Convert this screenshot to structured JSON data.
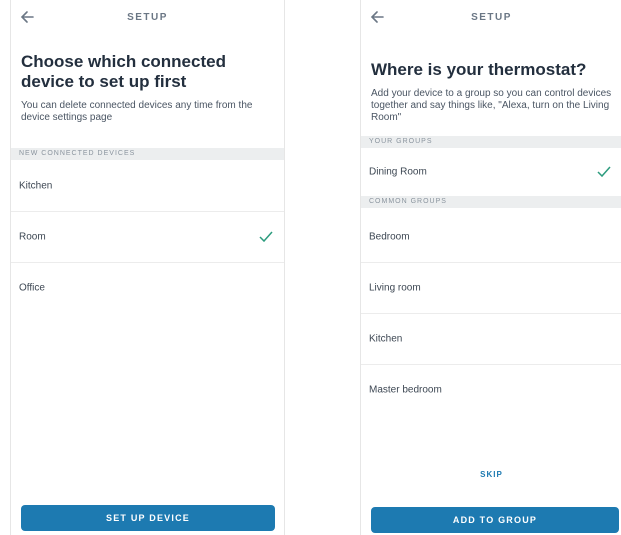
{
  "left_screen": {
    "header_title": "SETUP",
    "heading": "Choose which connected device to set up first",
    "description": "You can delete connected devices any time from the device settings page",
    "section_header": "NEW CONNECTED DEVICES",
    "devices": [
      {
        "label": "Kitchen",
        "selected": false
      },
      {
        "label": "Room",
        "selected": true
      },
      {
        "label": "Office",
        "selected": false
      }
    ],
    "primary_button": "SET UP DEVICE"
  },
  "right_screen": {
    "header_title": "SETUP",
    "heading": "Where is your thermostat?",
    "description": "Add your device to a group so you can control devices together and say things like, \"Alexa, turn on the Living Room\"",
    "your_groups_header": "YOUR GROUPS",
    "your_groups": [
      {
        "label": "Dining Room",
        "selected": true
      }
    ],
    "common_groups_header": "COMMON GROUPS",
    "common_groups": [
      {
        "label": "Bedroom"
      },
      {
        "label": "Living room"
      },
      {
        "label": "Kitchen"
      },
      {
        "label": "Master bedroom"
      }
    ],
    "skip_label": "SKIP",
    "primary_button": "ADD TO GROUP"
  },
  "colors": {
    "accent": "#1d7ab1",
    "check": "#2c9c7e",
    "heading": "#232f3e"
  },
  "icons": {
    "back": "back-arrow-icon",
    "check": "checkmark-icon"
  }
}
